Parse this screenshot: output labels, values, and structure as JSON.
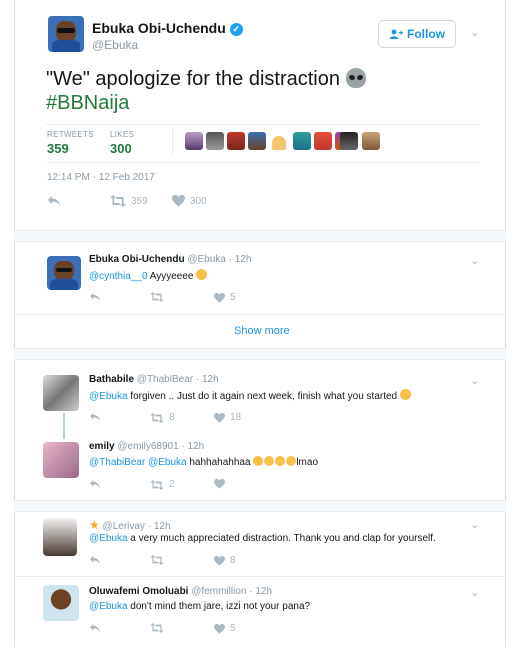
{
  "main_tweet": {
    "author_name": "Ebuka Obi-Uchendu",
    "handle": "@Ebuka",
    "follow_label": "Follow",
    "text": "\"We\" apologize for the distraction",
    "hashtag": "#BBNaija",
    "retweets_label": "RETWEETS",
    "retweets": "359",
    "likes_label": "LIKES",
    "likes": "300",
    "timestamp": "12:14 PM - 12 Feb 2017",
    "retweet_count": "359",
    "like_count": "300"
  },
  "replies": [
    {
      "name": "Ebuka Obi-Uchendu",
      "handle": "@Ebuka",
      "time": "12h",
      "mention": "@cynthia__0",
      "text": " Ayyyeeee",
      "likes": "5"
    },
    {
      "name": "Bathabile",
      "handle": "@ThabiBear",
      "time": "12h",
      "mention": "@Ebuka",
      "text": " forgiven .. Just do it again next week, finish what you started",
      "retweets": "8",
      "likes": "18"
    },
    {
      "name": "emily",
      "handle": "@emily68901",
      "time": "12h",
      "mention": "@ThabiBear @Ebuka",
      "text": " hahhahahhaa",
      "text_after": "lmao",
      "retweets": "2"
    },
    {
      "name": "",
      "handle": "@Lerivay",
      "time": "12h",
      "mention": "@Ebuka",
      "text": " a very much appreciated distraction. Thank you and clap for yourself.",
      "likes": "8"
    },
    {
      "name": "Oluwafemi Omoluabi",
      "handle": "@femmillion",
      "time": "12h",
      "mention": "@Ebuka",
      "text": " don't mind them jare, izzi not your pana?",
      "likes": "5"
    }
  ],
  "show_more_label": "Show more",
  "colors": {
    "link": "#1b95e0",
    "hashtag": "#217a3c",
    "muted": "#8899a6",
    "action": "#aab8c2"
  }
}
